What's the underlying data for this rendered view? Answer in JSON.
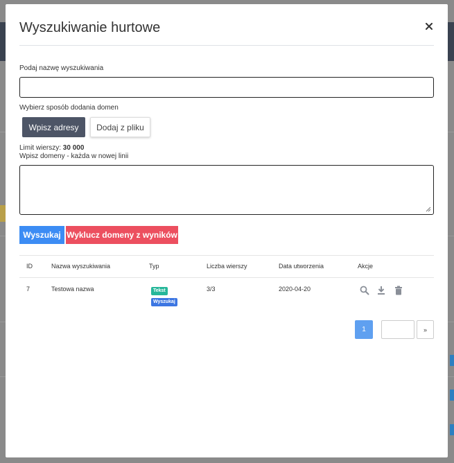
{
  "modal": {
    "title": "Wyszukiwanie hurtowe",
    "close_label": "×"
  },
  "form": {
    "name_label": "Podaj nazwę wyszukiwania",
    "name_value": "",
    "method_label": "Wybierz sposób dodania domen",
    "method_buttons": [
      "Wpisz adresy",
      "Dodaj z pliku"
    ],
    "limit_label": "Limit wierszy: ",
    "limit_value": "30 000",
    "domains_label": "Wpisz domeny - każda w nowej linii",
    "domains_value": "",
    "search_button": "Wyszukaj",
    "exclude_button": "Wyklucz domeny z wyników"
  },
  "table": {
    "headers": [
      "ID",
      "Nazwa wyszukiwania",
      "Typ",
      "Liczba wierszy",
      "Data utworzenia",
      "Akcje"
    ],
    "rows": [
      {
        "id": "7",
        "name": "Testowa nazwa",
        "tags": [
          "Tekst",
          "Wyszukaj"
        ],
        "count": "3/3",
        "date": "2020-04-20",
        "actions": [
          "search-icon",
          "download-icon",
          "trash-icon"
        ]
      }
    ]
  },
  "pagination": {
    "current": "1",
    "next": "»"
  },
  "colors": {
    "primary": "#3c8cf4",
    "danger": "#ec4f5f",
    "dark": "#4d5566",
    "tag_text": "#27b79a",
    "tag_search": "#3c76e2"
  }
}
